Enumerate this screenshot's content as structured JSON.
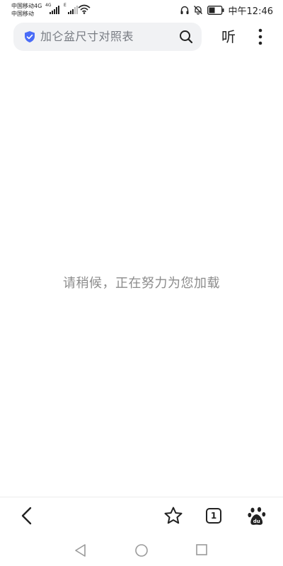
{
  "status_bar": {
    "carrier_1": "中国移动4G",
    "carrier_2": "中国移动",
    "signal_1_tag": "4G",
    "signal_2_tag": "E",
    "time": "中午12:46"
  },
  "top_bar": {
    "search_text": "加仑盆尺寸对照表",
    "listen_label": "听"
  },
  "content": {
    "loading_message": "请稍候，正在努力为您加载"
  },
  "toolbar": {
    "tab_count": "1"
  },
  "icons": {
    "shield": "shield-check-icon",
    "search": "search-icon",
    "more": "more-vertical-icon",
    "back": "back-arrow-icon",
    "star": "star-icon",
    "tabs": "tabs-icon",
    "paw": "baidu-paw-icon"
  },
  "colors": {
    "accent": "#4a6cf7",
    "search_bg": "#f1f2f4",
    "muted_text": "#8c8c8c"
  }
}
